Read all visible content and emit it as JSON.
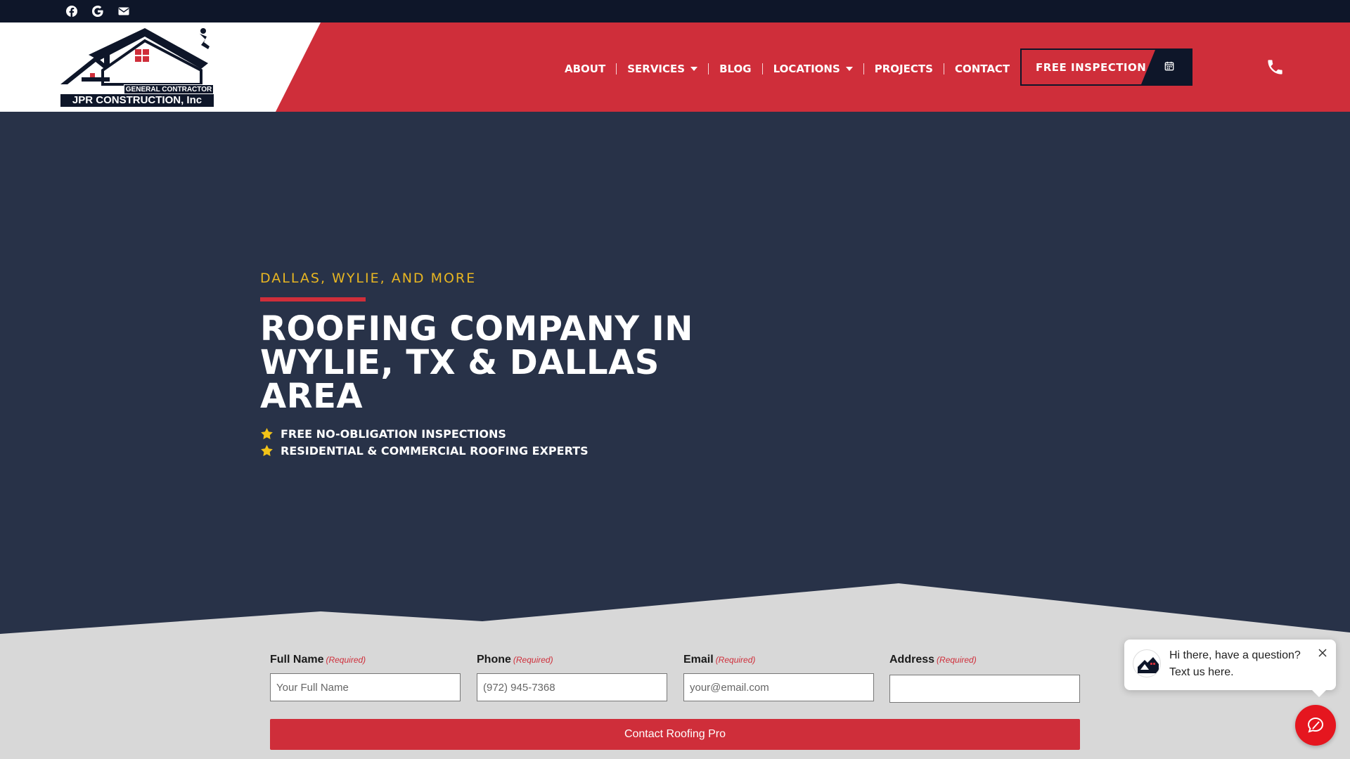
{
  "topbar": {
    "social": [
      {
        "icon": "facebook-icon"
      },
      {
        "icon": "google-icon"
      },
      {
        "icon": "email-icon"
      }
    ]
  },
  "header": {
    "logo": {
      "tagline": "GENERAL CONTRACTOR",
      "name": "JPR CONSTRUCTION, Inc"
    },
    "nav": [
      {
        "label": "ABOUT"
      },
      {
        "label": "SERVICES",
        "dropdown": true
      },
      {
        "label": "BLOG"
      },
      {
        "label": "LOCATIONS",
        "dropdown": true
      },
      {
        "label": "PROJECTS"
      },
      {
        "label": "CONTACT"
      }
    ],
    "cta": {
      "label": "FREE INSPECTION",
      "icon": "calendar-icon"
    },
    "phone_icon": "phone-icon"
  },
  "hero": {
    "eyebrow": "DALLAS, WYLIE, AND MORE",
    "headline": "ROOFING COMPANY IN WYLIE, TX & DALLAS AREA",
    "bullets": [
      "FREE NO-OBLIGATION INSPECTIONS",
      "RESIDENTIAL & COMMERCIAL ROOFING EXPERTS"
    ]
  },
  "form": {
    "required_label": "(Required)",
    "fields": [
      {
        "label": "Full Name",
        "placeholder": "Your Full Name",
        "value": ""
      },
      {
        "label": "Phone",
        "placeholder": "(972) 945-7368",
        "value": ""
      },
      {
        "label": "Email",
        "placeholder": "your@email.com",
        "value": ""
      },
      {
        "label": "Address",
        "placeholder": "",
        "value": ""
      }
    ],
    "submit_label": "Contact Roofing Pro"
  },
  "chat": {
    "line1": "Hi there, have a question?",
    "line2": "Text us here."
  },
  "colors": {
    "brand_red": "#cf2e3a",
    "navy": "#0e1629",
    "hero_bg": "#283248",
    "accent_yellow": "#e8b622"
  }
}
